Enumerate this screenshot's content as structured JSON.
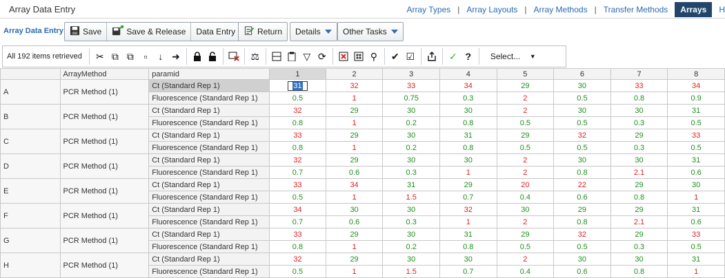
{
  "header": {
    "title": "Array Data Entry",
    "nav": [
      {
        "label": "Array Types"
      },
      {
        "label": "Array Layouts"
      },
      {
        "label": "Array Methods"
      },
      {
        "label": "Transfer Methods"
      }
    ],
    "active_tab": "Arrays",
    "overflow": "H"
  },
  "actionbar": {
    "section_title": "Array Data Entry",
    "save": "Save",
    "save_release": "Save & Release",
    "data_entry": "Data Entry",
    "return": "Return",
    "details": "Details",
    "other_tasks": "Other Tasks"
  },
  "gridtools": {
    "items_count": "All 192 items retrieved",
    "select_label": "Select..."
  },
  "grid": {
    "col_headers": {
      "row": "",
      "method": "ArrayMethod",
      "param": "paramid"
    },
    "columns": [
      "1",
      "2",
      "3",
      "4",
      "5",
      "6",
      "7",
      "8"
    ],
    "rows": [
      {
        "label": "A",
        "method": "PCR Method (1)",
        "ct": [
          "31",
          "32",
          "33",
          "34",
          "29",
          "30",
          "33",
          "34"
        ],
        "fl": [
          "0.5",
          "1",
          "0.75",
          "0.3",
          "2",
          "0.5",
          "0.8",
          "0.9"
        ]
      },
      {
        "label": "B",
        "method": "PCR Method (1)",
        "ct": [
          "32",
          "29",
          "30",
          "30",
          "2",
          "30",
          "30",
          "31"
        ],
        "fl": [
          "0.8",
          "1",
          "0.2",
          "0.8",
          "0.5",
          "0.5",
          "0.3",
          "0.5"
        ]
      },
      {
        "label": "C",
        "method": "PCR Method (1)",
        "ct": [
          "33",
          "29",
          "30",
          "31",
          "29",
          "32",
          "29",
          "33"
        ],
        "fl": [
          "0.8",
          "1",
          "0.2",
          "0.8",
          "0.5",
          "0.5",
          "0.3",
          "0.5"
        ]
      },
      {
        "label": "D",
        "method": "PCR Method (1)",
        "ct": [
          "32",
          "29",
          "30",
          "30",
          "2",
          "30",
          "30",
          "31"
        ],
        "fl": [
          "0.7",
          "0.6",
          "0.3",
          "1",
          "2",
          "0.8",
          "2.1",
          "0.6"
        ]
      },
      {
        "label": "E",
        "method": "PCR Method (1)",
        "ct": [
          "33",
          "34",
          "31",
          "29",
          "20",
          "22",
          "29",
          "30"
        ],
        "fl": [
          "0.5",
          "1",
          "1.5",
          "0.7",
          "0.4",
          "0.6",
          "0.8",
          "1"
        ]
      },
      {
        "label": "F",
        "method": "PCR Method (1)",
        "ct": [
          "34",
          "30",
          "30",
          "32",
          "30",
          "29",
          "29",
          "31"
        ],
        "fl": [
          "0.7",
          "0.6",
          "0.3",
          "1",
          "2",
          "0.8",
          "2.1",
          "0.6"
        ]
      },
      {
        "label": "G",
        "method": "PCR Method (1)",
        "ct": [
          "33",
          "29",
          "30",
          "31",
          "29",
          "32",
          "29",
          "33"
        ],
        "fl": [
          "0.8",
          "1",
          "0.2",
          "0.8",
          "0.5",
          "0.5",
          "0.3",
          "0.5"
        ]
      },
      {
        "label": "H",
        "method": "PCR Method (1)",
        "ct": [
          "32",
          "29",
          "30",
          "30",
          "2",
          "30",
          "30",
          "31"
        ],
        "fl": [
          "0.5",
          "1",
          "1.5",
          "0.7",
          "0.4",
          "0.6",
          "0.8",
          "1"
        ]
      }
    ],
    "ct_label": "Ct (Standard Rep 1)",
    "fl_label": "Fluorescence (Standard Rep 1)",
    "value_colors": {
      "high": "#e02020",
      "low": "#1d8f1d"
    },
    "ct_colors": [
      [
        "g",
        "r",
        "r",
        "r",
        "g",
        "g",
        "r",
        "r"
      ],
      [
        "r",
        "g",
        "g",
        "g",
        "r",
        "g",
        "g",
        "g"
      ],
      [
        "r",
        "g",
        "g",
        "g",
        "g",
        "r",
        "g",
        "r"
      ],
      [
        "r",
        "g",
        "g",
        "g",
        "r",
        "g",
        "g",
        "g"
      ],
      [
        "r",
        "r",
        "g",
        "g",
        "r",
        "r",
        "g",
        "g"
      ],
      [
        "r",
        "g",
        "g",
        "r",
        "g",
        "g",
        "g",
        "g"
      ],
      [
        "r",
        "g",
        "g",
        "g",
        "g",
        "r",
        "g",
        "r"
      ],
      [
        "r",
        "g",
        "g",
        "g",
        "r",
        "g",
        "g",
        "g"
      ]
    ],
    "fl_colors": [
      [
        "g",
        "r",
        "g",
        "g",
        "r",
        "g",
        "g",
        "g"
      ],
      [
        "g",
        "r",
        "g",
        "g",
        "g",
        "g",
        "g",
        "g"
      ],
      [
        "g",
        "r",
        "g",
        "g",
        "g",
        "g",
        "g",
        "g"
      ],
      [
        "g",
        "g",
        "g",
        "r",
        "r",
        "g",
        "r",
        "g"
      ],
      [
        "g",
        "r",
        "r",
        "g",
        "g",
        "g",
        "g",
        "r"
      ],
      [
        "g",
        "g",
        "g",
        "r",
        "r",
        "g",
        "r",
        "g"
      ],
      [
        "g",
        "r",
        "g",
        "g",
        "g",
        "g",
        "g",
        "g"
      ],
      [
        "g",
        "r",
        "r",
        "g",
        "g",
        "g",
        "g",
        "r"
      ]
    ]
  }
}
